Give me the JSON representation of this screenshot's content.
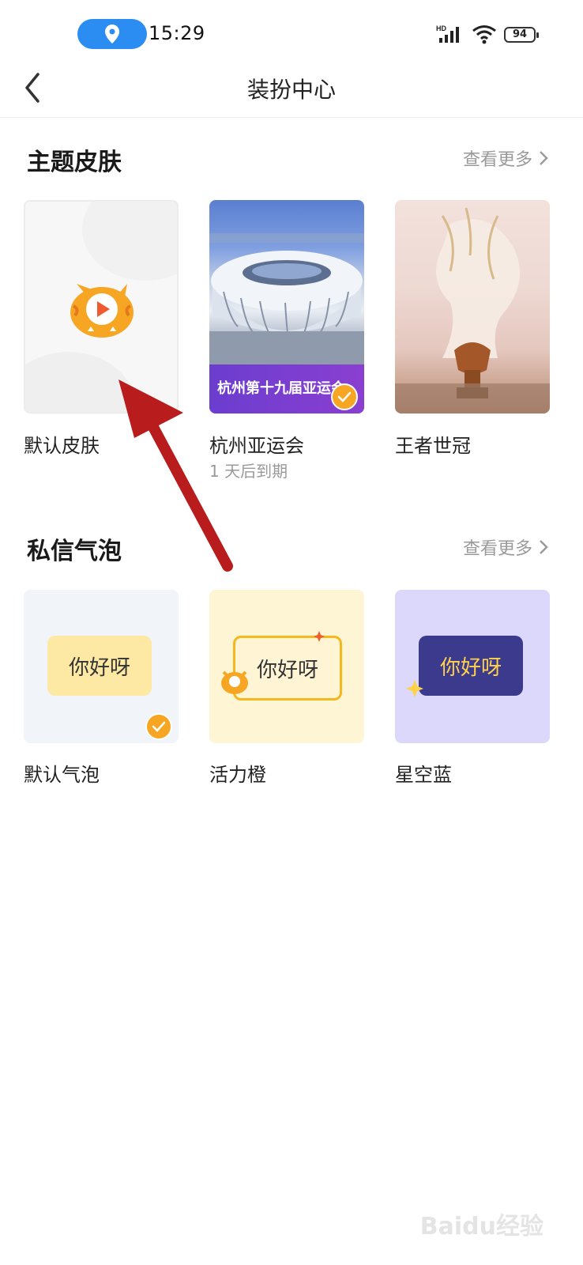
{
  "status_bar": {
    "time": "15:29",
    "network": "HD",
    "battery": "94"
  },
  "nav": {
    "title": "装扮中心"
  },
  "themes": {
    "title": "主题皮肤",
    "see_more": "查看更多",
    "items": [
      {
        "label": "默认皮肤",
        "sub": "",
        "selected": false
      },
      {
        "label": "杭州亚运会",
        "sub": "1 天后到期",
        "banner": "杭州第十九届亚运会",
        "selected": true
      },
      {
        "label": "王者世冠",
        "sub": "",
        "selected": false
      }
    ]
  },
  "bubbles": {
    "title": "私信气泡",
    "see_more": "查看更多",
    "items": [
      {
        "label": "默认气泡",
        "text": "你好呀",
        "selected": true
      },
      {
        "label": "活力橙",
        "text": "你好呀",
        "selected": false
      },
      {
        "label": "星空蓝",
        "text": "你好呀",
        "selected": false
      }
    ]
  },
  "watermark": "Baidu经验",
  "colors": {
    "accent": "#f6a623",
    "arrow": "#b81c1c",
    "location_pill": "#2b8cf2"
  }
}
